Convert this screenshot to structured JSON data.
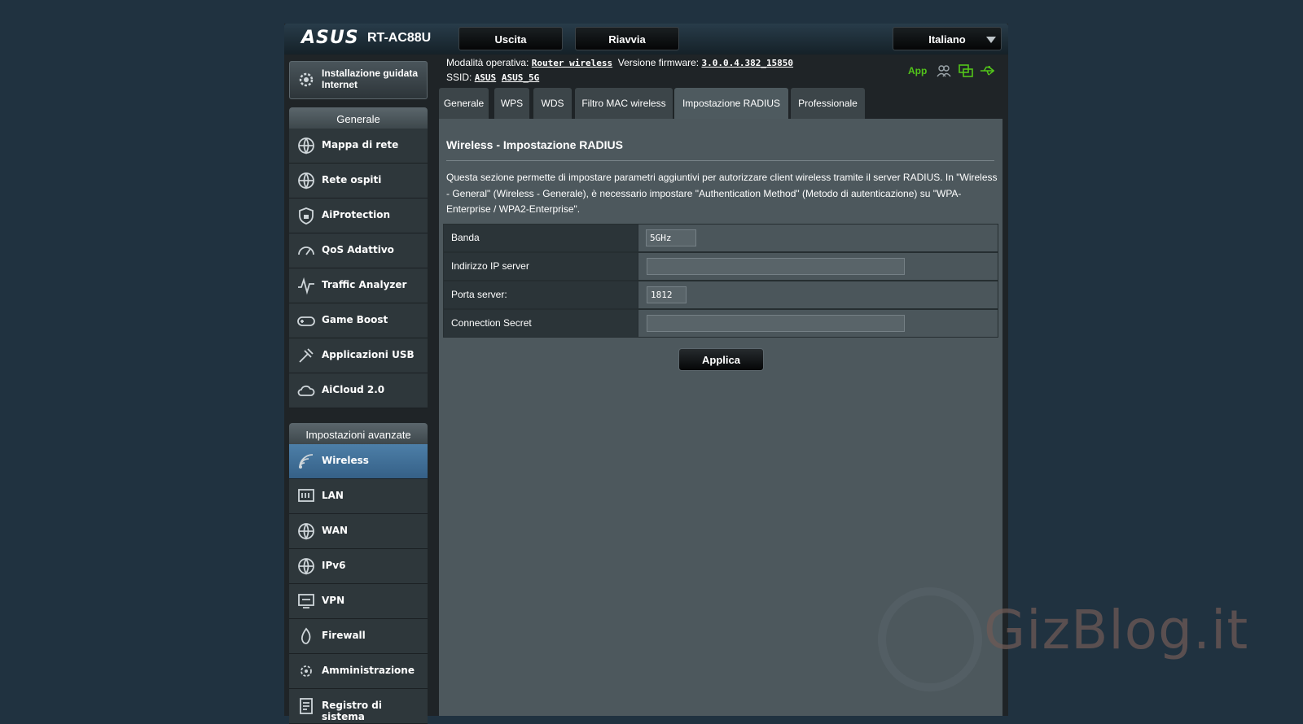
{
  "header": {
    "brand": "ASUS",
    "model": "RT-AC88U",
    "logout_label": "Uscita",
    "reboot_label": "Riavvia",
    "language": "Italiano"
  },
  "info": {
    "mode_label": "Modalità operativa:",
    "mode_value": "Router wireless",
    "fw_label": "Versione firmware:",
    "fw_value": "3.0.0.4.382_15850",
    "ssid_label": "SSID:",
    "ssid_1": "ASUS",
    "ssid_2": "ASUS_5G",
    "app_label": "App"
  },
  "sidebar": {
    "quick_setup": "Installazione guidata Internet",
    "general_header": "Generale",
    "general_items": [
      {
        "label": "Mappa di rete",
        "icon": "network-map-icon"
      },
      {
        "label": "Rete ospiti",
        "icon": "guest-network-icon"
      },
      {
        "label": "AiProtection",
        "icon": "shield-icon"
      },
      {
        "label": "QoS Adattivo",
        "icon": "speedometer-icon"
      },
      {
        "label": "Traffic Analyzer",
        "icon": "traffic-icon"
      },
      {
        "label": "Game Boost",
        "icon": "gamepad-icon"
      },
      {
        "label": "Applicazioni USB",
        "icon": "usb-app-icon"
      },
      {
        "label": "AiCloud 2.0",
        "icon": "cloud-icon"
      }
    ],
    "advanced_header": "Impostazioni avanzate",
    "advanced_items": [
      {
        "label": "Wireless",
        "icon": "wireless-icon",
        "active": true
      },
      {
        "label": "LAN",
        "icon": "lan-icon"
      },
      {
        "label": "WAN",
        "icon": "wan-globe-icon"
      },
      {
        "label": "IPv6",
        "icon": "ipv6-icon"
      },
      {
        "label": "VPN",
        "icon": "vpn-icon"
      },
      {
        "label": "Firewall",
        "icon": "firewall-icon"
      },
      {
        "label": "Amministrazione",
        "icon": "gear-icon"
      },
      {
        "label": "Registro di sistema",
        "icon": "log-icon"
      }
    ]
  },
  "tabs": [
    "Generale",
    "WPS",
    "WDS",
    "Filtro MAC wireless",
    "Impostazione RADIUS",
    "Professionale"
  ],
  "active_tab": "Impostazione RADIUS",
  "main": {
    "title": "Wireless - Impostazione RADIUS",
    "description": "Questa sezione permette di impostare parametri aggiuntivi per autorizzare client wireless tramite il server RADIUS. In \"Wireless - General\" (Wireless - Generale), è necessario impostare \"Authentication Method\" (Metodo di autenticazione) su \"WPA-Enterprise / WPA2-Enterprise\".",
    "fields": [
      {
        "label": "Banda",
        "value": "5GHz"
      },
      {
        "label": "Indirizzo IP server",
        "value": ""
      },
      {
        "label": "Porta server:",
        "value": "1812"
      },
      {
        "label": "Connection Secret",
        "value": ""
      }
    ],
    "apply_label": "Applica"
  },
  "watermark": "GizBlog.it",
  "colors": {
    "page_bg": "#203240",
    "active_menu": "#4d7fa8",
    "status_green": "#52c41a",
    "content_bg": "#4d585d"
  }
}
